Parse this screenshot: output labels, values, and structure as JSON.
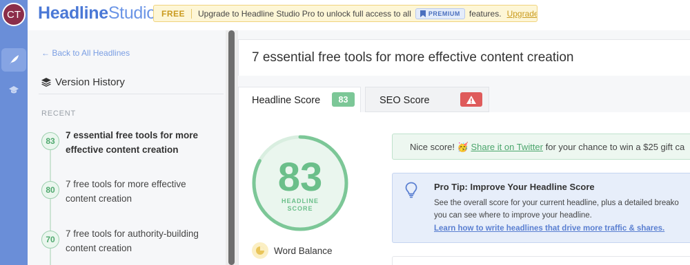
{
  "user": {
    "initials": "CT"
  },
  "brand": {
    "part1": "Headline",
    "part2": "Studio"
  },
  "banner": {
    "free_label": "FREE",
    "message": "Upgrade to Headline Studio Pro to unlock full access to all",
    "premium_label": "PREMIUM",
    "message_end": "features.",
    "upgrade_link": "Upgrade Now"
  },
  "sidebar": {
    "back_link": "← Back to All Headlines",
    "title": "Version History",
    "section_label": "RECENT",
    "items": [
      {
        "score": "83",
        "text": "7 essential free tools for more effective content creation"
      },
      {
        "score": "80",
        "text": "7 free tools for more effective content creation"
      },
      {
        "score": "70",
        "text": "7 free tools for authority-building content creation"
      }
    ]
  },
  "main": {
    "headline": "7 essential free tools for more effective content creation",
    "tabs": [
      {
        "label": "Headline Score",
        "badge": "83"
      },
      {
        "label": "SEO Score",
        "badge": "!"
      }
    ],
    "score": {
      "value": "83",
      "label_line1": "HEADLINE",
      "label_line2": "SCORE",
      "fraction": 0.83
    },
    "word_balance_label": "Word Balance",
    "nice_score": {
      "prefix": "Nice score! 🥳",
      "link": "Share it on Twitter",
      "suffix": "for your chance to win a $25 gift ca"
    },
    "pro_tip": {
      "title": "Pro Tip: Improve Your Headline Score",
      "line1": "See the overall score for your current headline, plus a detailed breako",
      "line2": "you can see where to improve your headline.",
      "link": "Learn how to write headlines that drive more traffic & shares."
    }
  },
  "colors": {
    "rail": "#6a8ed8",
    "score_green": "#7cc797",
    "seo_red": "#df5b5b",
    "brand_blue": "#4a78d6"
  }
}
